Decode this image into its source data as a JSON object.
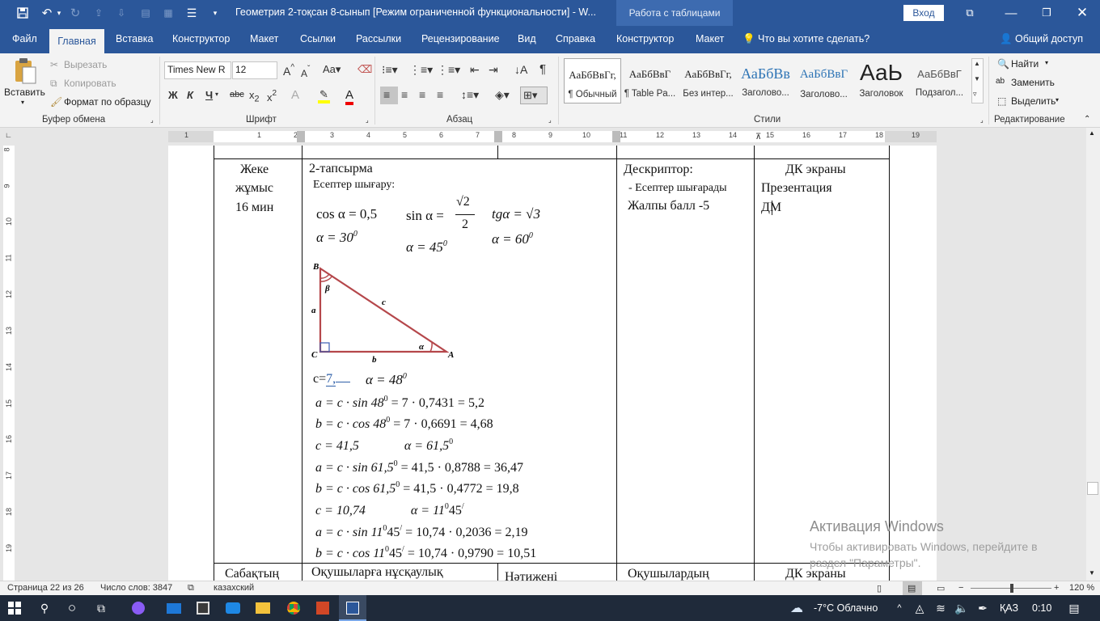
{
  "titlebar": {
    "title": "Геометрия 2-тоқсан 8-сынып [Режим ограниченной функциональности]  -  W...",
    "table_tools": "Работа с таблицами",
    "login": "Вход",
    "accent": "#2b579a"
  },
  "tabs": [
    "Файл",
    "Главная",
    "Вставка",
    "Конструктор",
    "Макет",
    "Ссылки",
    "Рассылки",
    "Рецензирование",
    "Вид",
    "Справка",
    "Конструктор",
    "Макет"
  ],
  "tell_me": "Что вы хотите сделать?",
  "share": "Общий доступ",
  "ribbon": {
    "clipboard": {
      "paste": "Вставить",
      "cut": "Вырезать",
      "copy": "Копировать",
      "format_painter": "Формат по образцу",
      "label": "Буфер обмена"
    },
    "font": {
      "name": "Times New R",
      "size": "12",
      "label": "Шрифт",
      "bold": "Ж",
      "italic": "К",
      "underline": "Ч",
      "strike": "abc"
    },
    "paragraph": {
      "label": "Абзац"
    },
    "styles": {
      "label": "Стили",
      "items": [
        {
          "sample": "АаБбВвГг,",
          "name": "¶ Обычный"
        },
        {
          "sample": "АаБбВвГ",
          "name": "¶ Table Pa..."
        },
        {
          "sample": "АаБбВвГг,",
          "name": "Без интер..."
        },
        {
          "sample": "АаБбВв",
          "name": "Заголово..."
        },
        {
          "sample": "АаБбВвГ",
          "name": "Заголово..."
        },
        {
          "sample": "АаЬ",
          "name": "Заголовок"
        },
        {
          "sample": "АаБбВвГ",
          "name": "Подзагол..."
        }
      ]
    },
    "editing": {
      "find": "Найти",
      "replace": "Заменить",
      "select": "Выделить",
      "label": "Редактирование"
    }
  },
  "ruler": {
    "h_numbers": [
      "1",
      "1",
      "2",
      "3",
      "4",
      "5",
      "6",
      "7",
      "8",
      "9",
      "10",
      "11",
      "12",
      "13",
      "14",
      "15",
      "16",
      "17",
      "18",
      "19"
    ],
    "v_numbers": [
      "8",
      "9",
      "10",
      "11",
      "12",
      "13",
      "14",
      "15",
      "16",
      "17",
      "18",
      "19"
    ]
  },
  "document": {
    "col1": {
      "line1": "Жеке",
      "line2": "жұмыс",
      "line3": "16 мин"
    },
    "task_title": "2-тапсырма",
    "task_sub": "Есептер шығару:",
    "formulas_top": {
      "f1": "cos α = 0,5",
      "f2": "sin α =",
      "f2_num": "√2",
      "f2_den": "2",
      "f3": "tgα = √3",
      "f4": "α = 30",
      "f5": "α = 45",
      "f6": "α = 60",
      "deg": "0"
    },
    "triangle": {
      "B": "B",
      "C": "C",
      "A": "A",
      "a": "a",
      "b": "b",
      "c": "c",
      "alpha": "α",
      "beta": "β",
      "color": "#b5474b"
    },
    "given_c": "c=",
    "given_c_val": "7,",
    "given_alpha": "α = 48",
    "lines": [
      {
        "pre": "a = c · sin  48",
        "sup": "0",
        "post": "  = 7 · 0,7431  = 5,2"
      },
      {
        "pre": "b = c · cos 48",
        "sup": "0",
        "post": "  = 7 · 0,6691  = 4,68"
      },
      {
        "pre": "c = 41,5              α = 61,5",
        "sup": "0",
        "post": ""
      },
      {
        "pre": "a = c · sin  61,5",
        "sup": "0",
        "post": "  = 41,5 · 0,8788  = 36,47"
      },
      {
        "pre": "b = c · cos 61,5",
        "sup": "0",
        "post": "  = 41,5 · 0,4772  = 19,8"
      },
      {
        "pre": "c = 10,74              α = 11",
        "sup": "0",
        "post": "45",
        "sup2": "/"
      },
      {
        "pre": "a = c · sin 11",
        "sup": "0",
        "post": "45",
        "sup2": "/",
        "post2": "  = 10,74 · 0,2036  = 2,19"
      },
      {
        "pre": "b = c · cos 11",
        "sup": "0",
        "post": "45",
        "sup2": "/",
        "post2": "  = 10,74 · 0,9790  = 10,51"
      }
    ],
    "col3": {
      "title": "Дескриптор:",
      "item": "- Есептер шығарады",
      "score": "Жалпы балл -5"
    },
    "col4": {
      "line1": "ДК экраны",
      "line2": "Презентация",
      "line3": "ДМ"
    },
    "next_row": {
      "c1": "Сабақтың",
      "c2": "Оқушыларға нұсқаулық",
      "c3": "Нәтижені",
      "c4": "Оқушылардың",
      "c5": "ДК экраны"
    }
  },
  "watermark": {
    "title": "Активация Windows",
    "sub1": "Чтобы активировать Windows, перейдите в",
    "sub2": "раздел \"Параметры\"."
  },
  "status": {
    "page": "Страница 22 из 26",
    "words": "Число слов: 3847",
    "lang": "казахский",
    "zoom": "120 %"
  },
  "taskbar": {
    "weather": "-7°C  Облачно",
    "lang": "ҚАЗ",
    "time": "0:10"
  }
}
